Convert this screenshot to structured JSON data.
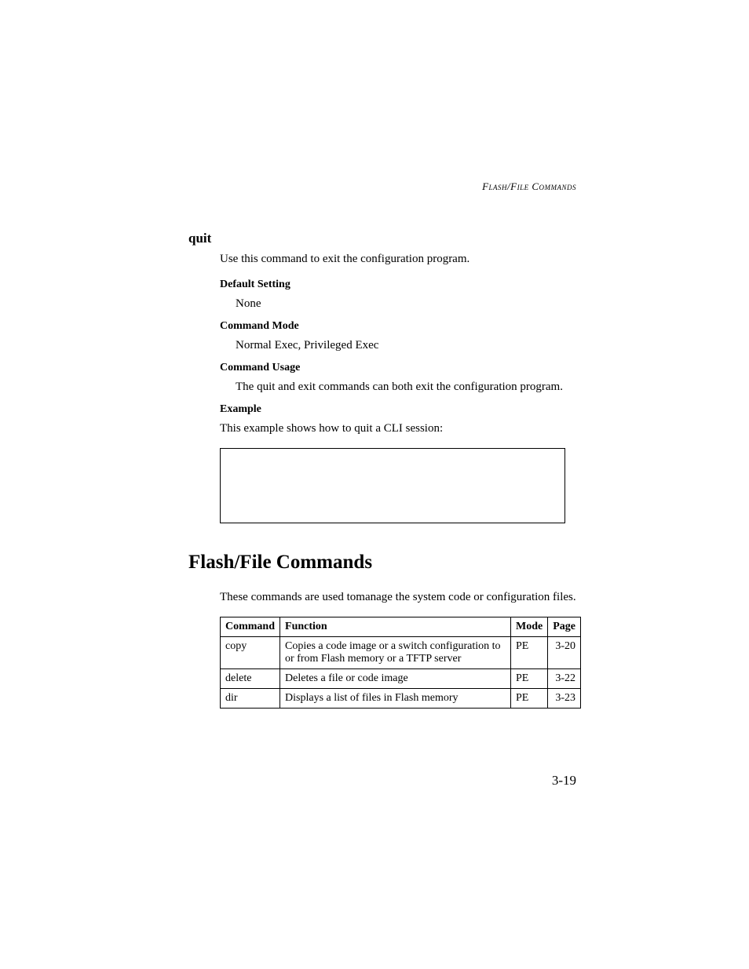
{
  "running_header": "Flash/File Commands",
  "quit": {
    "title": "quit",
    "intro": "Use this command to exit the configuration program.",
    "default_setting": {
      "label": "Default Setting",
      "value": "None"
    },
    "command_mode": {
      "label": "Command Mode",
      "value": "Normal Exec, Privileged Exec"
    },
    "command_usage": {
      "label": "Command Usage",
      "value": "The quit and exit commands can both exit the configuration program."
    },
    "example": {
      "label": "Example",
      "intro": "This example shows how to quit a CLI session:"
    }
  },
  "section": {
    "title": "Flash/File Commands",
    "intro": "These commands are used tomanage the system code or configuration files.",
    "table": {
      "headers": {
        "command": "Command",
        "function": "Function",
        "mode": "Mode",
        "page": "Page"
      },
      "rows": [
        {
          "command": "copy",
          "function": "Copies a code image or a switch configuration to or from Flash memory or a TFTP server",
          "mode": "PE",
          "page": "3-20"
        },
        {
          "command": "delete",
          "function": "Deletes a file or code image",
          "mode": "PE",
          "page": "3-22"
        },
        {
          "command": "dir",
          "function": "Displays a list of files in Flash memory",
          "mode": "PE",
          "page": "3-23"
        }
      ]
    }
  },
  "page_number": "3-19"
}
